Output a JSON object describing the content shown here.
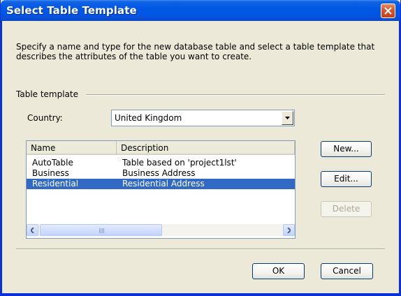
{
  "window": {
    "title": "Select Table Template"
  },
  "description": "Specify a name and type for the new database table and select a table template that describes the attributes of the table you want to create.",
  "template_group": {
    "label": "Table template",
    "country_label": "Country:",
    "country_value": "United Kingdom"
  },
  "list": {
    "columns": [
      "Name",
      "Description"
    ],
    "rows": [
      {
        "name": "AutoTable",
        "description": "Table based on 'project1lst'"
      },
      {
        "name": "Business",
        "description": "Business Address"
      },
      {
        "name": "Residential",
        "description": "Residential Address",
        "selected": true
      }
    ]
  },
  "buttons": {
    "new": "New...",
    "edit": "Edit...",
    "delete": "Delete",
    "ok": "OK",
    "cancel": "Cancel"
  },
  "colors": {
    "titlebar": "#0058e6",
    "selection": "#316ac5",
    "dialog_bg": "#ece9d8",
    "close": "#d8542b"
  },
  "icons": [
    "close-icon",
    "dropdown-arrow-icon",
    "scroll-left-icon",
    "scroll-right-icon"
  ]
}
